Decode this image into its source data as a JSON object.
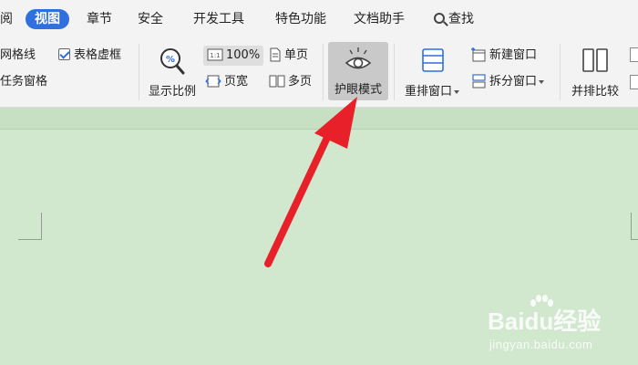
{
  "tabs": [
    {
      "label": "阅",
      "active": false
    },
    {
      "label": "视图",
      "active": true
    },
    {
      "label": "章节",
      "active": false
    },
    {
      "label": "安全",
      "active": false
    },
    {
      "label": "开发工具",
      "active": false
    },
    {
      "label": "特色功能",
      "active": false
    },
    {
      "label": "文档助手",
      "active": false
    }
  ],
  "search": {
    "label": "查找"
  },
  "ribbon": {
    "gridlines": {
      "label": "网格线"
    },
    "table_gridlines": {
      "label": "表格虚框",
      "checked": true
    },
    "task_pane": {
      "label": "任务窗格"
    },
    "zoom": {
      "label": "显示比例"
    },
    "zoom_100": {
      "label": "100%"
    },
    "page_width": {
      "label": "页宽"
    },
    "single_page": {
      "label": "单页"
    },
    "multi_page": {
      "label": "多页"
    },
    "eye_protection": {
      "label": "护眼模式"
    },
    "rearrange_windows": {
      "label": "重排窗口"
    },
    "new_window": {
      "label": "新建窗口"
    },
    "split_window": {
      "label": "拆分窗口"
    },
    "side_by_side": {
      "label": "并排比较"
    }
  },
  "watermark": {
    "brand": "Baidu经验",
    "url": "jingyan.baidu.com"
  },
  "colors": {
    "accent": "#2f6fe0",
    "document_bg": "#d1e8cf",
    "arrow": "#e8202a"
  }
}
